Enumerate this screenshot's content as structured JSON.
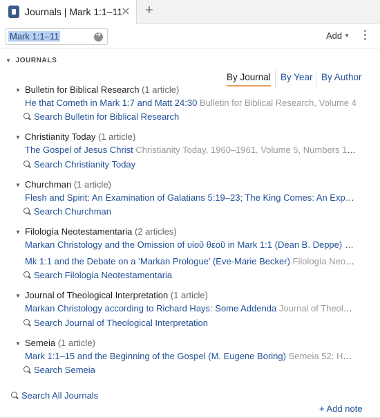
{
  "tab": {
    "title": "Journals | Mark 1:1–11",
    "close_glyph": "✕",
    "add_glyph": "+"
  },
  "toolbar": {
    "reference": "Mark 1:1–11",
    "add_label": "Add"
  },
  "section": {
    "title": "JOURNALS"
  },
  "view_tabs": [
    "By Journal",
    "By Year",
    "By Author"
  ],
  "groups": [
    {
      "title": "Bulletin for Biblical Research",
      "count": "(1 article)",
      "articles": [
        {
          "title": "He that Cometh in Mark 1:7 and Matt 24:30",
          "source": "Bulletin for Biblical Research, Volume 4"
        }
      ],
      "search": "Search Bulletin for Biblical Research"
    },
    {
      "title": "Christianity Today",
      "count": "(1 article)",
      "articles": [
        {
          "title": "The Gospel of Jesus Christ",
          "source": "Christianity Today, 1960–1961, Volume 5, Numbers 1–25"
        }
      ],
      "search": "Search Christianity Today"
    },
    {
      "title": "Churchman",
      "count": "(1 article)",
      "articles": [
        {
          "title": "Flesh and Spirit: An Examination of Galatians 5:19–23; The King Comes: An Expos…",
          "source": "."
        }
      ],
      "search": "Search Churchman"
    },
    {
      "title": "Filología Neotestamentaria",
      "count": "(2 articles)",
      "articles": [
        {
          "title": "Markan Christology and the Omission of υἱοῦ θεοῦ in Mark 1:1 (Dean B. Deppe)",
          "source": "Fil…"
        },
        {
          "title": "Mk 1:1 and the Debate on a ‘Markan Prologue’ (Eve-Marie Becker)",
          "source": "Filología Neote…"
        }
      ],
      "search": "Search Filología Neotestamentaria"
    },
    {
      "title": "Journal of Theological Interpretation",
      "count": "(1 article)",
      "articles": [
        {
          "title": "Markan Christology according to Richard Hays: Some Addenda",
          "source": "Journal of Theolo…"
        }
      ],
      "search": "Search Journal of Theological Interpretation"
    },
    {
      "title": "Semeia",
      "count": "(1 article)",
      "articles": [
        {
          "title": "Mark 1:1–15 and the Beginning of the Gospel (M. Eugene Boring)",
          "source": "Semeia 52: How…"
        }
      ],
      "search": "Search Semeia"
    }
  ],
  "footer": {
    "search_all": "Search All Journals",
    "add_note": "+ Add note"
  }
}
